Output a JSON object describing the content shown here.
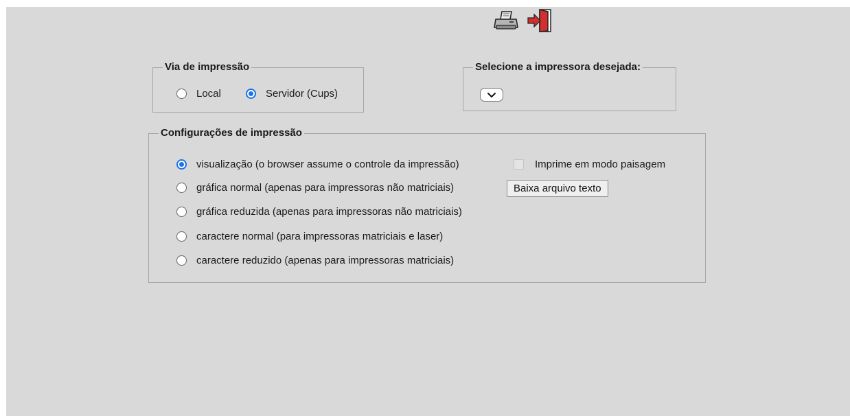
{
  "toolbar": {
    "print_icon": "printer-icon",
    "exit_icon": "exit-door-icon"
  },
  "via_impressao": {
    "legend": "Via de impressão",
    "options": [
      {
        "label": "Local",
        "checked": false
      },
      {
        "label": "Servidor (Cups)",
        "checked": true
      }
    ]
  },
  "impressora": {
    "legend": "Selecione a impressora desejada:",
    "selected": ""
  },
  "configuracoes": {
    "legend": "Configurações de impressão",
    "options": [
      {
        "label": "visualização (o browser assume o controle da impressão)",
        "checked": true
      },
      {
        "label": "gráfica normal (apenas para impressoras não matriciais)",
        "checked": false
      },
      {
        "label": "gráfica reduzida (apenas para impressoras não matriciais)",
        "checked": false
      },
      {
        "label": "caractere normal (para impressoras matriciais e laser)",
        "checked": false
      },
      {
        "label": "caractere reduzido (apenas para impressoras matriciais)",
        "checked": false
      }
    ],
    "landscape_label": "Imprime em modo paisagem",
    "landscape_checked": false,
    "download_button": "Baixa arquivo texto"
  },
  "colors": {
    "panel_bg": "#d9d9d9",
    "radio_accent": "#1a73e8",
    "exit_red": "#d32f2f"
  }
}
